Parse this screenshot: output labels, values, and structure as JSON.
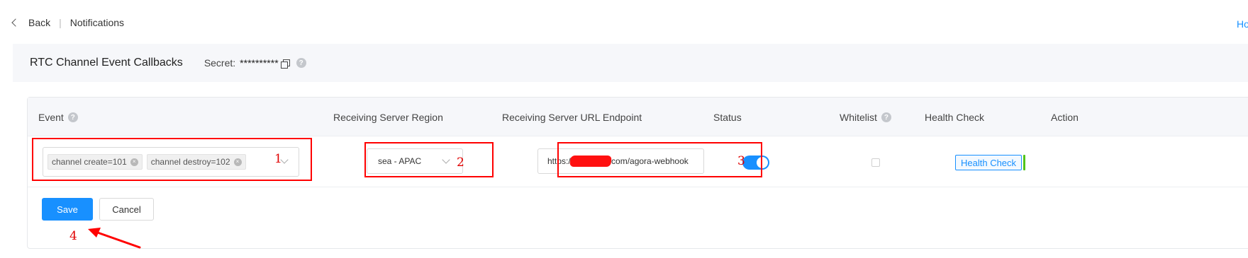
{
  "nav": {
    "back_label": "Back",
    "separator": "|",
    "page_label": "Notifications",
    "right_link": "Ho"
  },
  "section": {
    "title": "RTC Channel Event Callbacks",
    "secret_label": "Secret:",
    "secret_value": "**********",
    "help_glyph": "?"
  },
  "table": {
    "headers": {
      "event": "Event",
      "region": "Receiving Server Region",
      "url": "Receiving Server URL Endpoint",
      "status": "Status",
      "whitelist": "Whitelist",
      "health": "Health Check",
      "action": "Action"
    },
    "row": {
      "event_tags": [
        "channel create=101",
        "channel destroy=102"
      ],
      "tag_close_glyph": "×",
      "region_value": "sea - APAC",
      "url_prefix": "https://",
      "url_suffix": "com/agora-webhook",
      "status_enabled": true,
      "whitelist_checked": false,
      "health_button": "Health Check"
    }
  },
  "buttons": {
    "save": "Save",
    "cancel": "Cancel"
  },
  "annotations": {
    "labels": [
      "1",
      "2",
      "3",
      "4"
    ],
    "color": "#ff0000"
  },
  "colors": {
    "primary": "#1890ff",
    "header_bg": "#f6f7fa",
    "success": "#52c41a"
  }
}
